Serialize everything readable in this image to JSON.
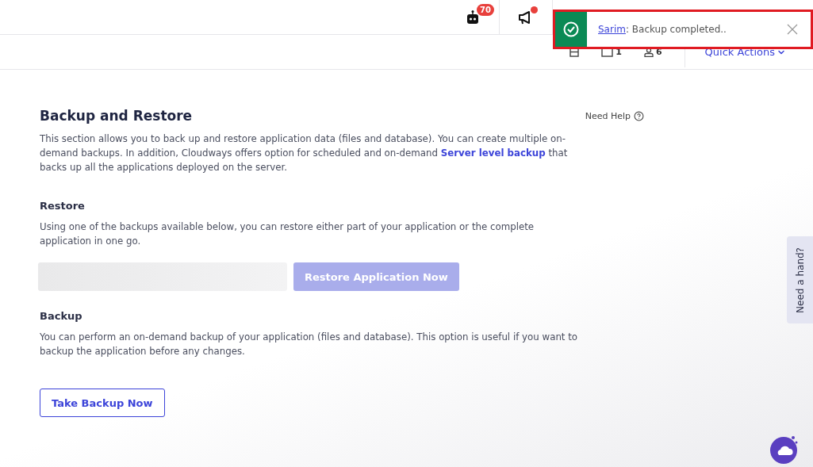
{
  "header": {
    "bot_badge": "70",
    "announcement_unread": true,
    "stats": [
      {
        "kind": "server"
      },
      {
        "kind": "app",
        "count": "1"
      },
      {
        "kind": "user",
        "count": "6"
      }
    ],
    "quick_actions": "Quick Actions"
  },
  "toast": {
    "user": "Sarim",
    "message": ": Backup completed.."
  },
  "section": {
    "title": "Backup and Restore",
    "help": "Need Help",
    "intro_before": "This section allows you to back up and restore application data (files and database). You can create multiple on-demand backups. In addition, Cloudways offers option for scheduled and on-demand ",
    "intro_link": "Server level backup",
    "intro_after": " that backs up all the applications deployed on the server."
  },
  "restore": {
    "title": "Restore",
    "text": "Using one of the backups available below, you can restore either part of your application or the complete application in one go.",
    "button": "Restore Application Now",
    "button_disabled": true
  },
  "backup": {
    "title": "Backup",
    "text": "You can perform an on-demand backup of your application (files and database). This option is useful if you want to backup the application before any changes.",
    "button": "Take Backup Now"
  },
  "side_tab": "Need a hand?"
}
